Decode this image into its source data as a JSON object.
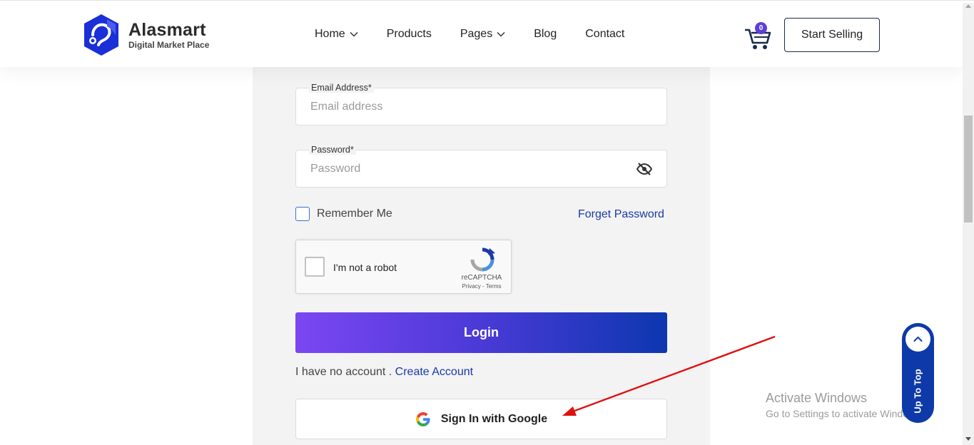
{
  "brand": {
    "name": "Alasmart",
    "tagline": "Digital Market Place",
    "logo_icon": "hexagon-logo-icon",
    "logo_color": "#1a2fd8"
  },
  "nav": {
    "items": [
      {
        "label": "Home",
        "has_dropdown": true
      },
      {
        "label": "Products",
        "has_dropdown": false
      },
      {
        "label": "Pages",
        "has_dropdown": true
      },
      {
        "label": "Blog",
        "has_dropdown": false
      },
      {
        "label": "Contact",
        "has_dropdown": false
      }
    ],
    "cart_count": "0",
    "start_selling_label": "Start Selling"
  },
  "form": {
    "email": {
      "label": "Email Address*",
      "placeholder": "Email address",
      "value": ""
    },
    "password": {
      "label": "Password*",
      "placeholder": "Password",
      "value": ""
    },
    "remember_label": "Remember Me",
    "forget_label": "Forget Password",
    "recaptcha": {
      "label": "I'm not a robot",
      "brand": "reCAPTCHA",
      "links": "Privacy - Terms"
    },
    "login_label": "Login",
    "no_account_text": "I have no account .",
    "create_account_label": "Create Account",
    "google_label": "Sign In with Google"
  },
  "colors": {
    "accent_gradient_start": "#7c46f3",
    "accent_gradient_end": "#0c37b0",
    "link": "#1a3aa6",
    "annotation_arrow": "#e01010",
    "up_to_top_bg": "#0d3aa8"
  },
  "watermark": {
    "title": "Activate Windows",
    "subtitle": "Go to Settings to activate Windows."
  },
  "up_to_top_label": "Up To Top"
}
